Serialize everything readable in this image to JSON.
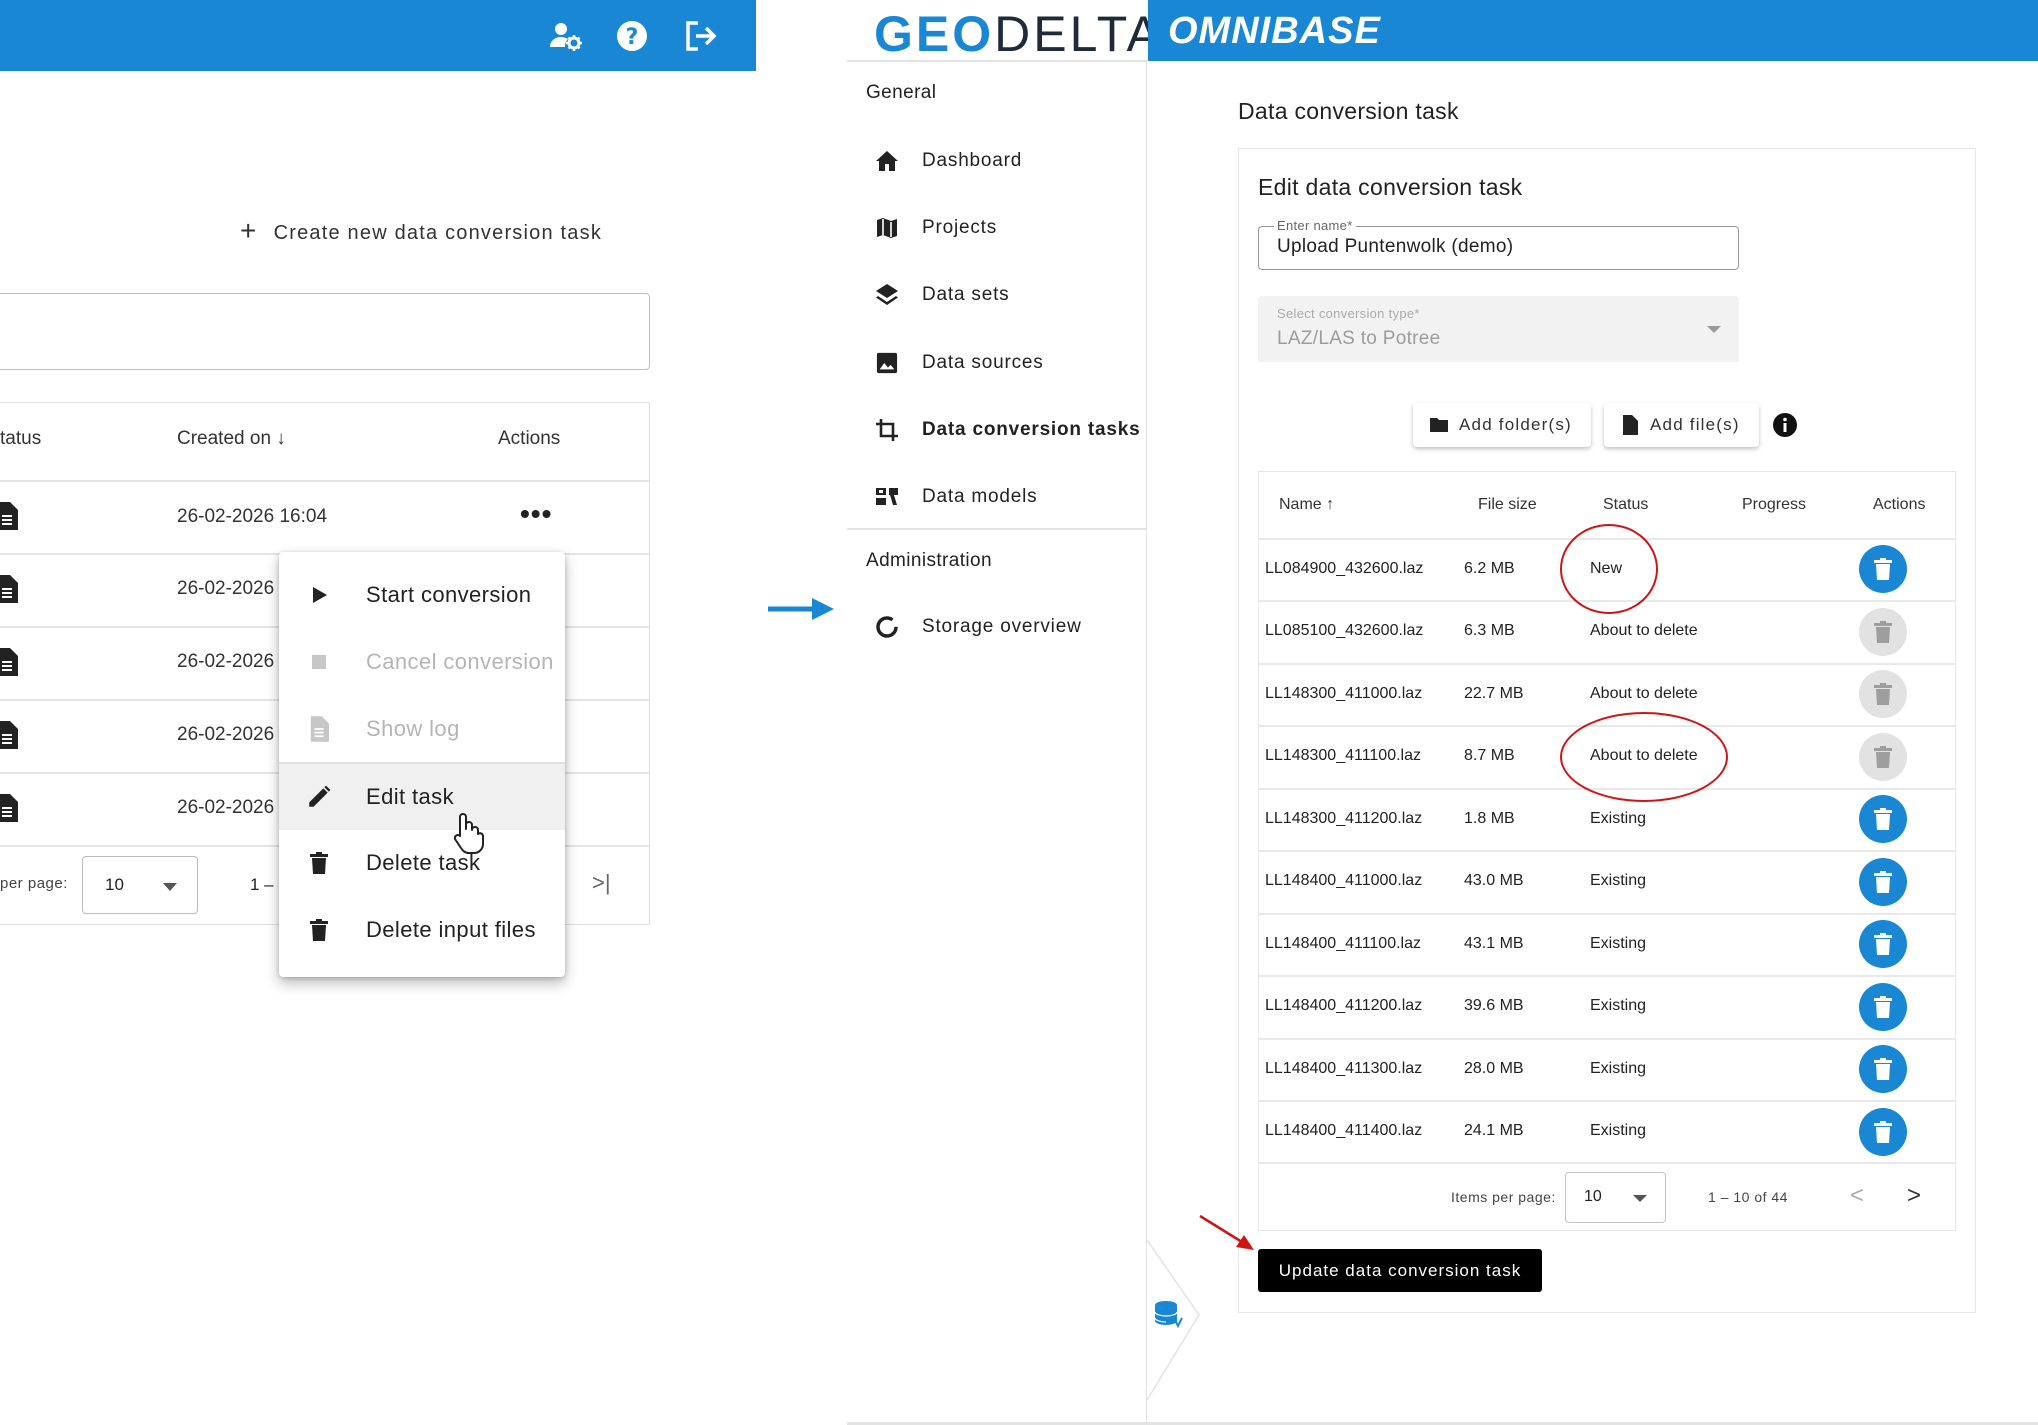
{
  "left_panel": {
    "create_button_label": "Create new data conversion task",
    "table": {
      "headers": {
        "status": "tatus",
        "created_on": "Created on",
        "actions": "Actions"
      },
      "rows": [
        {
          "created_on": "26-02-2026 16:04"
        },
        {
          "created_on": "26-02-2026"
        },
        {
          "created_on": "26-02-2026"
        },
        {
          "created_on": "26-02-2026"
        },
        {
          "created_on": "26-02-2026"
        }
      ],
      "more_label": "•••",
      "per_page_label": "per page:",
      "per_page_value": "10",
      "range_partial": "1 –",
      "last_page_label": ">|"
    },
    "context_menu": [
      {
        "label": "Start conversion",
        "icon": "play-icon",
        "disabled": false
      },
      {
        "label": "Cancel conversion",
        "icon": "stop-icon",
        "disabled": true
      },
      {
        "label": "Show log",
        "icon": "document-icon",
        "disabled": true
      },
      {
        "label": "Edit task",
        "icon": "pencil-icon",
        "disabled": false,
        "hovered": true
      },
      {
        "label": "Delete task",
        "icon": "trash-icon",
        "disabled": false
      },
      {
        "label": "Delete input files",
        "icon": "trash-icon",
        "disabled": false
      }
    ]
  },
  "header": {
    "logo_left": "GEO",
    "logo_right": "DELTA",
    "product": "OMNIBASE"
  },
  "sidebar": {
    "sections": [
      {
        "title": "General",
        "items": [
          {
            "label": "Dashboard",
            "icon": "home-icon"
          },
          {
            "label": "Projects",
            "icon": "map-icon"
          },
          {
            "label": "Data sets",
            "icon": "layers-icon"
          },
          {
            "label": "Data sources",
            "icon": "image-icon"
          },
          {
            "label": "Data conversion tasks",
            "icon": "crop-icon",
            "active": true
          },
          {
            "label": "Data models",
            "icon": "model-icon"
          }
        ]
      },
      {
        "title": "Administration",
        "items": [
          {
            "label": "Storage overview",
            "icon": "donut-icon"
          }
        ]
      }
    ]
  },
  "main": {
    "page_title": "Data conversion task",
    "card_title": "Edit data conversion task",
    "name_field": {
      "label": "Enter name*",
      "value": "Upload Puntenwolk (demo)"
    },
    "type_field": {
      "label": "Select conversion type*",
      "value": "LAZ/LAS to Potree"
    },
    "buttons": {
      "add_folders": "Add folder(s)",
      "add_files": "Add file(s)",
      "update": "Update data conversion task"
    },
    "file_table": {
      "headers": {
        "name": "Name",
        "size": "File size",
        "status": "Status",
        "progress": "Progress",
        "actions": "Actions"
      },
      "rows": [
        {
          "name": "LL084900_432600.laz",
          "size": "6.2 MB",
          "status": "New",
          "action_enabled": true
        },
        {
          "name": "LL085100_432600.laz",
          "size": "6.3 MB",
          "status": "About to delete",
          "action_enabled": false
        },
        {
          "name": "LL148300_411000.laz",
          "size": "22.7 MB",
          "status": "About to delete",
          "action_enabled": false
        },
        {
          "name": "LL148300_411100.laz",
          "size": "8.7 MB",
          "status": "About to delete",
          "action_enabled": false
        },
        {
          "name": "LL148300_411200.laz",
          "size": "1.8 MB",
          "status": "Existing",
          "action_enabled": true
        },
        {
          "name": "LL148400_411000.laz",
          "size": "43.0 MB",
          "status": "Existing",
          "action_enabled": true
        },
        {
          "name": "LL148400_411100.laz",
          "size": "43.1 MB",
          "status": "Existing",
          "action_enabled": true
        },
        {
          "name": "LL148400_411200.laz",
          "size": "39.6 MB",
          "status": "Existing",
          "action_enabled": true
        },
        {
          "name": "LL148400_411300.laz",
          "size": "28.0 MB",
          "status": "Existing",
          "action_enabled": true
        },
        {
          "name": "LL148400_411400.laz",
          "size": "24.1 MB",
          "status": "Existing",
          "action_enabled": true
        }
      ],
      "items_per_page_label": "Items per page:",
      "items_per_page_value": "10",
      "range": "1 – 10 of 44",
      "prev_label": "<",
      "next_label": ">"
    }
  },
  "colors": {
    "brand_blue": "#1a87d5",
    "annotation_red": "#d01414",
    "disabled_grey": "#e2e2e2"
  }
}
